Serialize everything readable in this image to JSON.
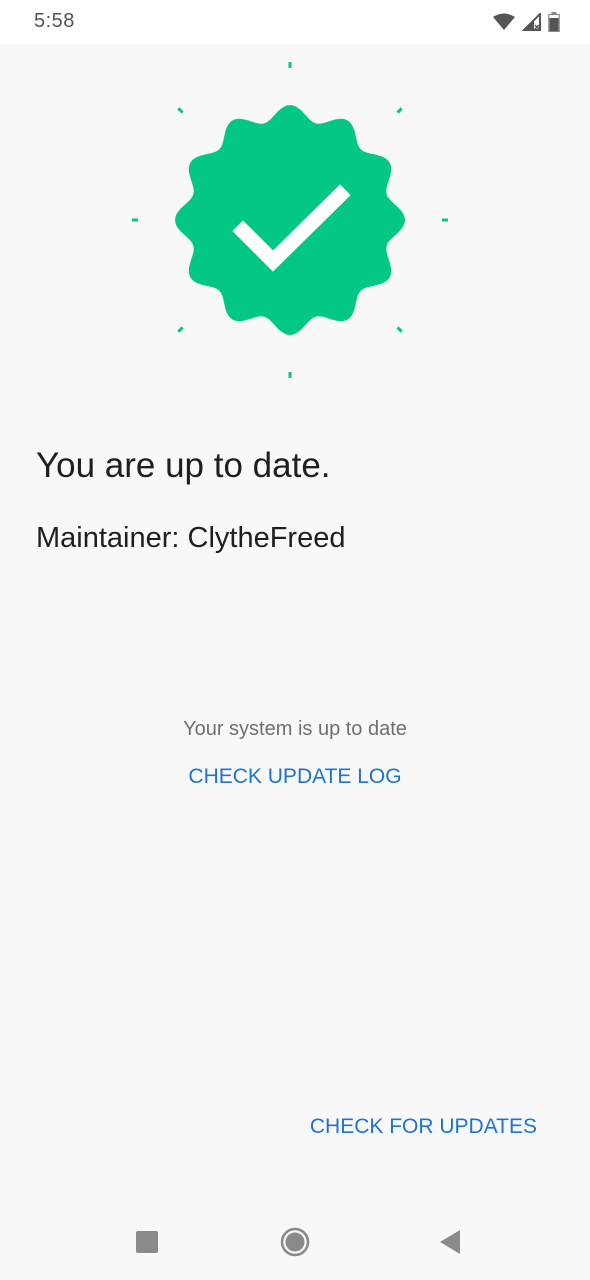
{
  "status_bar": {
    "time": "5:58",
    "icons": [
      "wifi-icon",
      "signal-icon",
      "battery-icon"
    ]
  },
  "badge": {
    "icon": "check-badge-icon",
    "color": "#03c885"
  },
  "main": {
    "title": "You are up to date.",
    "maintainer": "Maintainer: ClytheFreed",
    "system_status": "Your system is up to date",
    "update_log_label": "CHECK UPDATE LOG"
  },
  "footer": {
    "check_updates_label": "CHECK FOR UPDATES"
  },
  "nav": {
    "buttons": [
      "recents-icon",
      "home-icon",
      "back-icon"
    ]
  },
  "colors": {
    "accent": "#1e73d2",
    "success": "#03c885"
  }
}
